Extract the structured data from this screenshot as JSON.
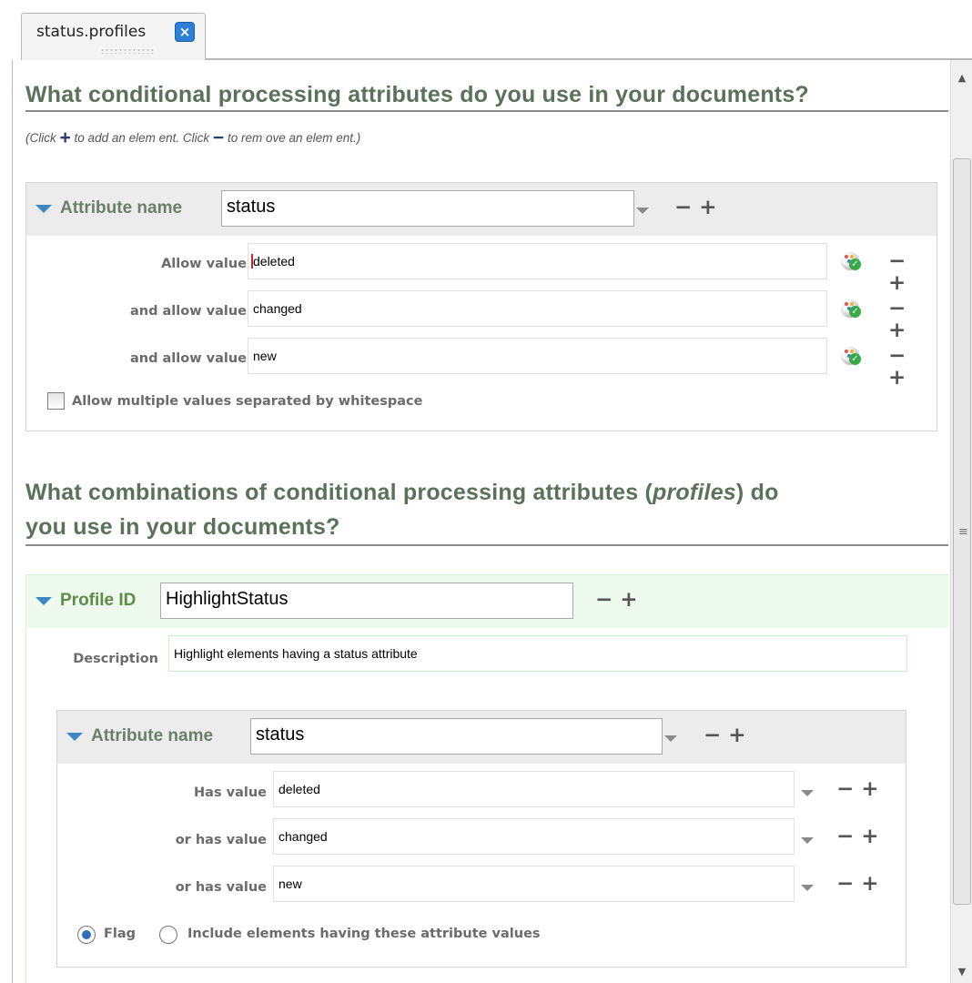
{
  "tab": {
    "title": "status.profiles",
    "close_glyph": "×"
  },
  "scrollbar": {
    "up": "▲",
    "down": "▼",
    "grip": "≡"
  },
  "section1": {
    "question": "What conditional processing attributes do you use in your documents?",
    "hint_prefix": "(Click",
    "hint_plus": "+",
    "hint_mid": "to add an elem ent. Click",
    "hint_minus": "−",
    "hint_suffix": "to rem ove an elem ent.)",
    "attribute": {
      "label": "Attribute name",
      "value": "status",
      "values": [
        {
          "label": "Allow value",
          "value": "deleted"
        },
        {
          "label": "and allow value",
          "value": "changed"
        },
        {
          "label": "and allow value",
          "value": "new"
        }
      ],
      "multiple_label": "Allow multiple values separated by whitespace"
    }
  },
  "section2": {
    "question_line1": "What combinations of conditional processing attributes (",
    "question_italic": "profiles",
    "question_line1_end": ") do",
    "question_line2": "you use in your documents?",
    "profile": {
      "label": "Profile ID",
      "value": "HighlightStatus",
      "description_label": "Description",
      "description": "Highlight elements having a status attribute",
      "attribute": {
        "label": "Attribute name",
        "value": "status",
        "values": [
          {
            "label": "Has value",
            "value": "deleted"
          },
          {
            "label": "or has value",
            "value": "changed"
          },
          {
            "label": "or has value",
            "value": "new"
          }
        ]
      },
      "radio_flag": "Flag",
      "radio_include": "Include elements having these attribute values"
    }
  },
  "controls": {
    "minus": "−",
    "plus": "+"
  },
  "colors": {
    "heading": "#5a7259",
    "profile_label": "#5e8b48",
    "triangle": "#3d86c6",
    "tab_close": "#2e7fd6"
  },
  "icons": [
    "close-icon",
    "expand-triangle-icon",
    "dropdown-arrow-icon",
    "spellcheck-icon"
  ]
}
